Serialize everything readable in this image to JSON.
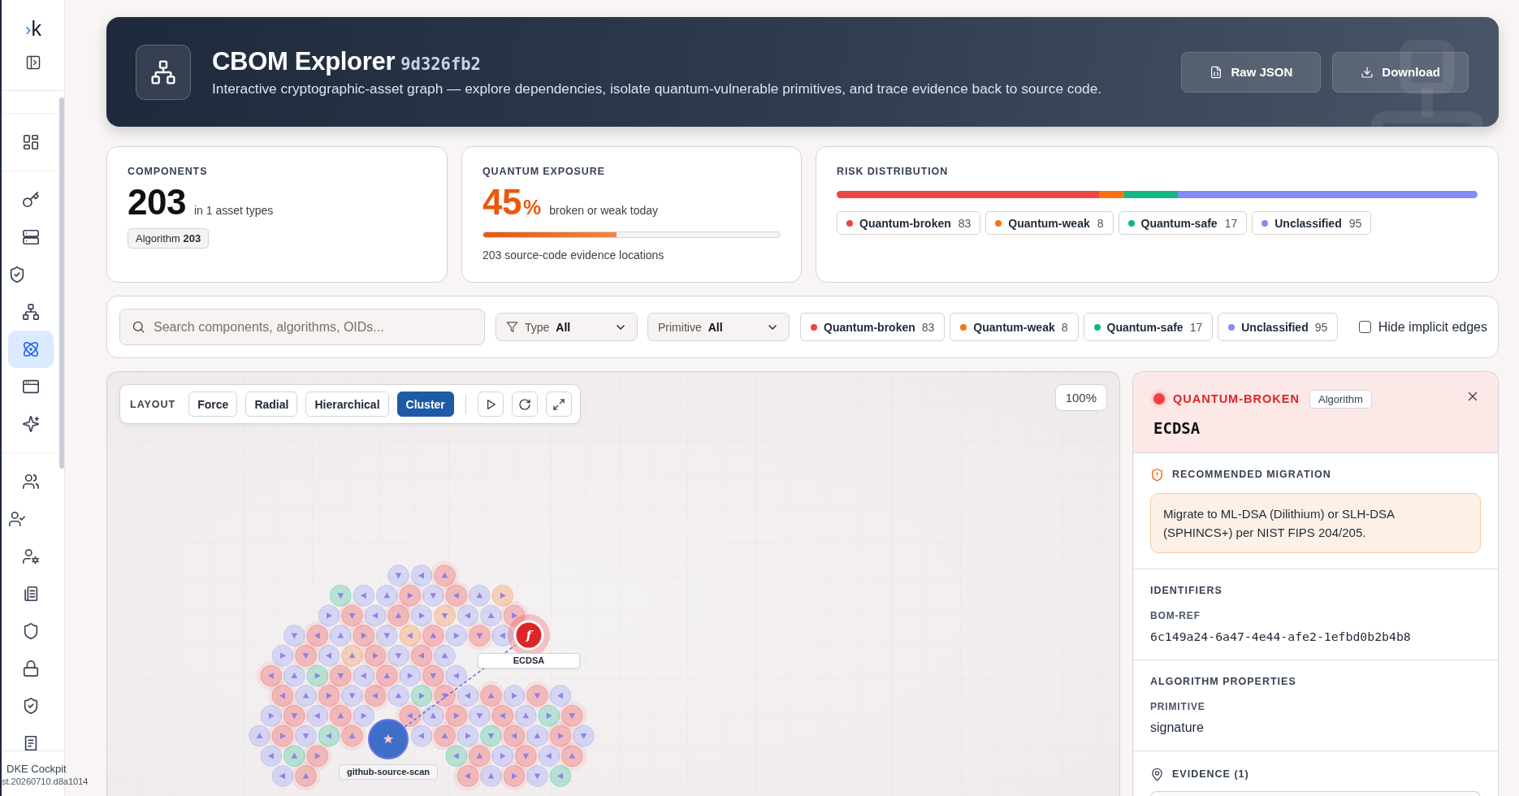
{
  "sidebar": {
    "logo": {
      "mark": "›",
      "letter": "k"
    },
    "groups": [
      {
        "items": [
          {
            "selected": false
          }
        ]
      },
      {
        "items": [
          {
            "selected": false
          },
          {
            "selected": false
          },
          {
            "selected": false
          },
          {
            "selected": false
          },
          {
            "selected": true
          },
          {
            "selected": false
          },
          {
            "selected": false
          }
        ]
      },
      {
        "items": [
          {
            "selected": false
          },
          {
            "selected": false
          },
          {
            "selected": false
          },
          {
            "selected": false
          },
          {
            "selected": false
          },
          {
            "selected": false
          },
          {
            "selected": false
          },
          {
            "selected": false
          }
        ]
      }
    ],
    "footer": {
      "title": "DKE Cockpit",
      "build": "st.20260710.d8a1014"
    }
  },
  "header": {
    "title": "CBOM Explorer",
    "hash": "9d326fb2",
    "subtitle": "Interactive cryptographic-asset graph — explore dependencies, isolate quantum-vulnerable primitives, and trace evidence back to source code.",
    "buttons": [
      {
        "label": "Raw JSON"
      },
      {
        "label": "Download"
      }
    ]
  },
  "stats": {
    "components": {
      "label": "COMPONENTS",
      "value": "203",
      "caption": "in 1 asset types",
      "badges": [
        "Algorithm **203**"
      ]
    },
    "exposure": {
      "label": "QUANTUM EXPOSURE",
      "value": "45",
      "unit": "%",
      "caption": "broken or weak today",
      "level": 0.45,
      "note": "203 source-code evidence locations"
    },
    "risk": {
      "label": "RISK DISTRIBUTION",
      "classes": [
        {
          "name": "Quantum-broken",
          "count": "83",
          "color": "#ef4444"
        },
        {
          "name": "Quantum-weak",
          "count": "8",
          "color": "#f97316"
        },
        {
          "name": "Quantum-safe",
          "count": "17",
          "color": "#10b981"
        },
        {
          "name": "Unclassified",
          "count": "95",
          "color": "#818cf8"
        }
      ]
    }
  },
  "filters": {
    "search": {
      "placeholder": "Search components, algorithms, OIDs..."
    },
    "selects": [
      {
        "label": "Type",
        "value": "All"
      },
      {
        "label": "Primitive",
        "value": "All"
      }
    ],
    "chips": [
      {
        "name": "Quantum-broken",
        "count": "83",
        "color": "#ef4444"
      },
      {
        "name": "Quantum-weak",
        "count": "8",
        "color": "#f97316"
      },
      {
        "name": "Quantum-safe",
        "count": "17",
        "color": "#10b981"
      },
      {
        "name": "Unclassified",
        "count": "95",
        "color": "#818cf8"
      }
    ],
    "hide_implicit_edges": {
      "label": "Hide implicit edges",
      "checked": false
    }
  },
  "graph": {
    "layout_label": "LAYOUT",
    "layouts": [
      {
        "label": "Force",
        "selected": false
      },
      {
        "label": "Radial",
        "selected": false
      },
      {
        "label": "Hierarchical",
        "selected": false
      },
      {
        "label": "Cluster",
        "selected": true
      }
    ],
    "zoom": "100%",
    "nodes": [
      {
        "kind": "algorithm",
        "glyph": "f",
        "label": "ECDSA",
        "selected": true
      },
      {
        "kind": "source",
        "label": "github-source-scan",
        "selected": false
      }
    ]
  },
  "details": {
    "status": "QUANTUM-BROKEN",
    "badge": "Algorithm",
    "title": "ECDSA",
    "sections": [
      {
        "kind": "migration",
        "heading": "RECOMMENDED MIGRATION",
        "text": "Migrate to ML-DSA (Dilithium) or SLH-DSA (SPHINCS+) per NIST FIPS 204/205."
      },
      {
        "kind": "fields",
        "heading": "IDENTIFIERS",
        "fields": [
          {
            "label": "BOM-REF",
            "value": "6c149a24-6a47-4e44-afe2-1efbd0b2b4b8",
            "mono": true
          }
        ]
      },
      {
        "kind": "fields",
        "heading": "ALGORITHM PROPERTIES",
        "fields": [
          {
            "label": "PRIMITIVE",
            "value": "signature",
            "mono": false
          }
        ]
      },
      {
        "kind": "evidence",
        "heading": "EVIDENCE (1)"
      }
    ]
  }
}
